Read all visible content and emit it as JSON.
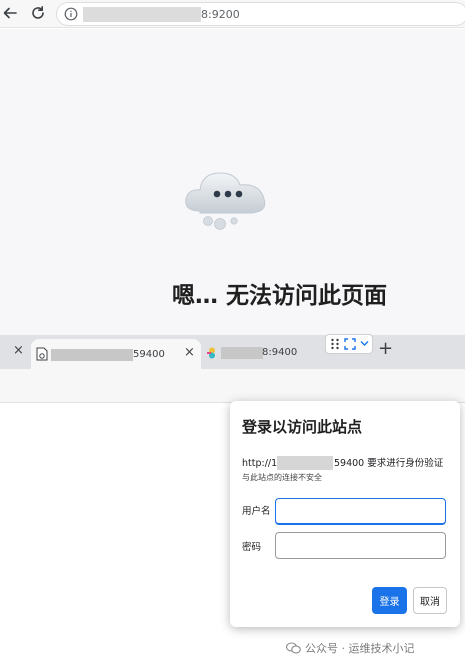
{
  "browser": {
    "url_visible": "8:9200"
  },
  "error_page": {
    "title": "嗯… 无法访问此页面"
  },
  "tabs": [
    {
      "label": "59400",
      "close": "×"
    },
    {
      "label": "8:9400",
      "close": "×"
    }
  ],
  "first_tab_close": "×",
  "new_tab": "+",
  "login_dialog": {
    "title": "登录以访问此站点",
    "url_prefix": "http://1",
    "url_suffix": "59400 要求进行身份验证",
    "warning": "与此站点的连接不安全",
    "username_label": "用户名",
    "username_value": "",
    "password_label": "密码",
    "password_value": "",
    "login_button": "登录",
    "cancel_button": "取消"
  },
  "watermark": "公众号 · 运维技术小记",
  "colors": {
    "accent": "#1a73e8",
    "tabstrip": "#dfe1e4",
    "page_bg": "#f7f7f9"
  }
}
